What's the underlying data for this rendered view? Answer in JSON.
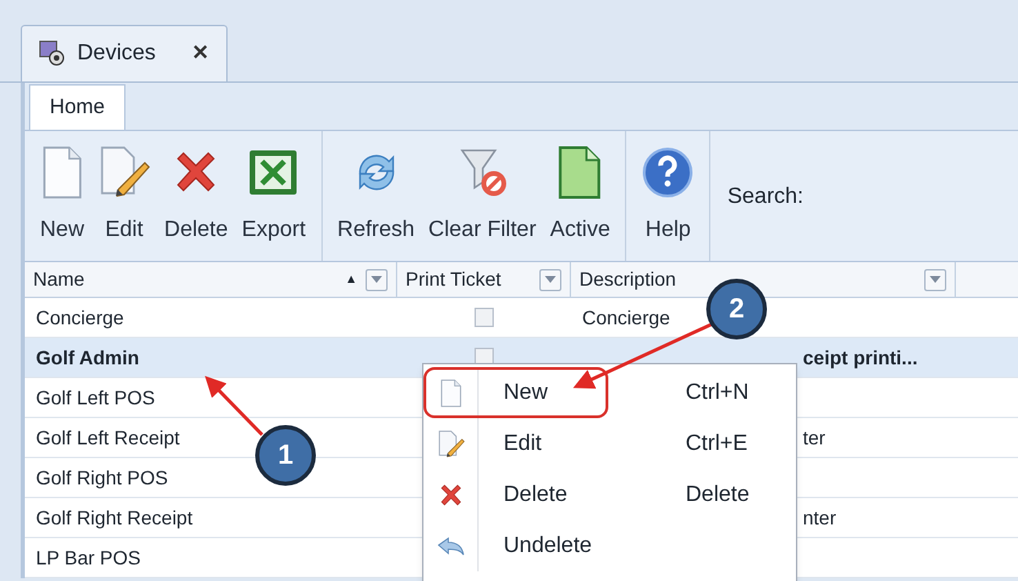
{
  "document_tab": {
    "title": "Devices",
    "close": "✕"
  },
  "ribbon_tabs": [
    {
      "label": "Home",
      "selected": true
    }
  ],
  "toolbar": {
    "groups": [
      [
        {
          "label": "New",
          "kind": "new"
        },
        {
          "label": "Edit",
          "kind": "edit"
        },
        {
          "label": "Delete",
          "kind": "delete"
        },
        {
          "label": "Export",
          "kind": "export"
        }
      ],
      [
        {
          "label": "Refresh",
          "kind": "refresh"
        },
        {
          "label": "Clear Filter",
          "kind": "clear-filter"
        },
        {
          "label": "Active",
          "kind": "active"
        }
      ],
      [
        {
          "label": "Help",
          "kind": "help"
        }
      ]
    ],
    "search_label": "Search:"
  },
  "table": {
    "columns": [
      {
        "label": "Name",
        "sort": "▲",
        "filter": true
      },
      {
        "label": "Print Ticket",
        "filter": true
      },
      {
        "label": "Description",
        "filter": true
      }
    ],
    "rows": [
      {
        "name": "Concierge",
        "selected": false,
        "print_ticket": {
          "checked": false
        },
        "description": "Concierge"
      },
      {
        "name": "Golf Admin",
        "selected": true,
        "print_ticket": {
          "checked": false
        },
        "description": "ceipt printi...",
        "partly_hidden": true
      },
      {
        "name": "Golf Left POS",
        "selected": false
      },
      {
        "name": "Golf Left Receipt",
        "selected": false,
        "description": "ter",
        "partly_hidden": true
      },
      {
        "name": "Golf Right POS",
        "selected": false
      },
      {
        "name": "Golf Right Receipt",
        "selected": false,
        "description": "nter",
        "partly_hidden": true
      },
      {
        "name": "LP Bar POS",
        "selected": false
      }
    ]
  },
  "context_menu": {
    "items": [
      {
        "label": "New",
        "shortcut": "Ctrl+N",
        "kind": "new",
        "highlighted": true
      },
      {
        "label": "Edit",
        "shortcut": "Ctrl+E",
        "kind": "edit",
        "highlighted": false
      },
      {
        "label": "Delete",
        "shortcut": "Delete",
        "kind": "delete",
        "highlighted": false
      },
      {
        "label": "Undelete",
        "kind": "undo",
        "highlighted": false
      }
    ]
  },
  "callouts": [
    {
      "number": "1"
    },
    {
      "number": "2"
    }
  ]
}
